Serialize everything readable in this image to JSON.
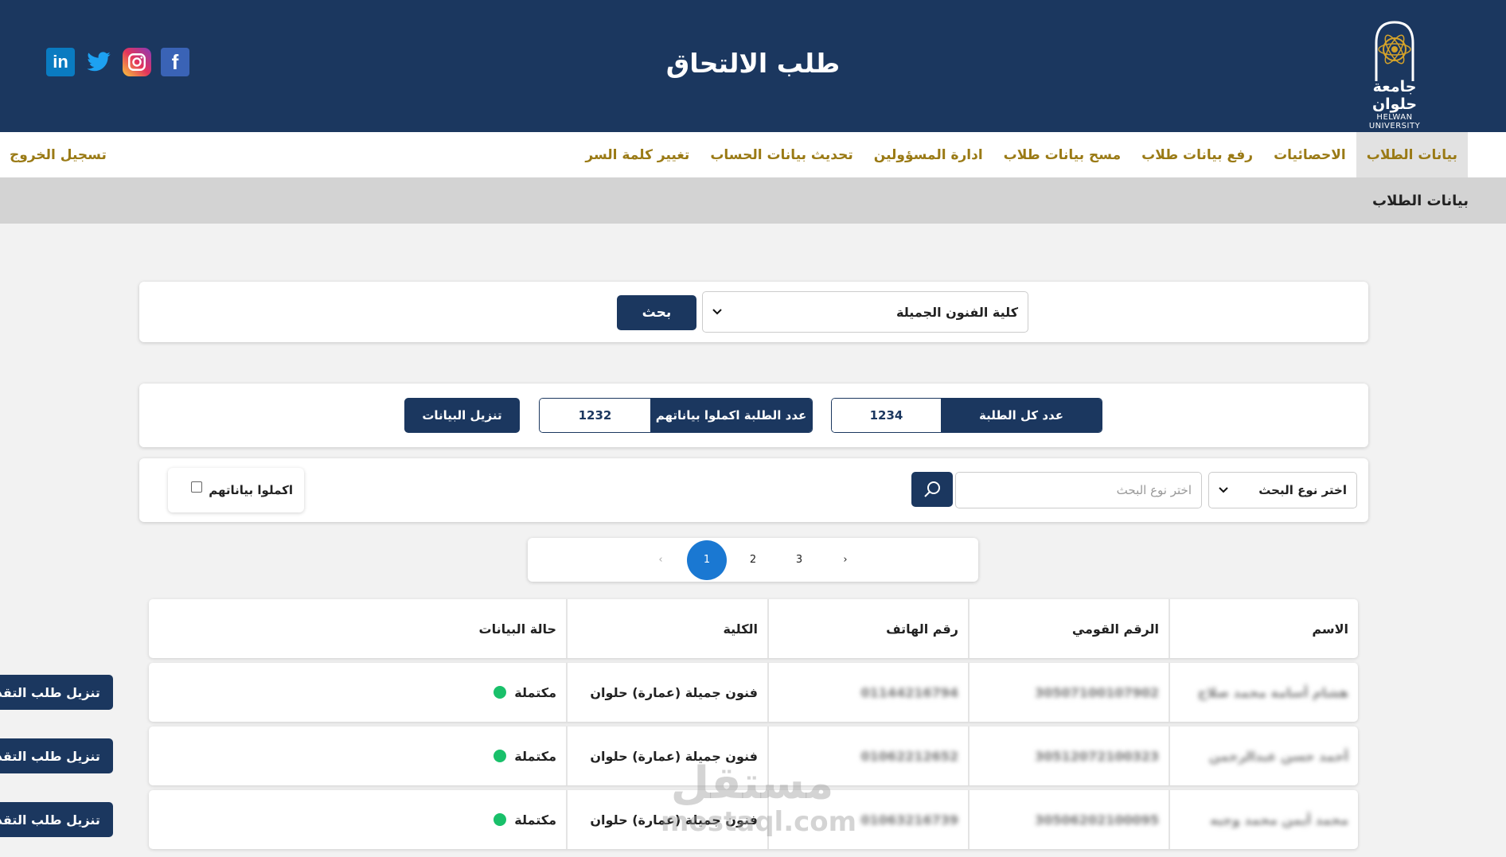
{
  "header": {
    "title": "طلب الالتحاق",
    "logo_ar": "جامعة حلوان",
    "logo_en": "HELWAN UNIVERSITY",
    "social": [
      "linkedin-icon",
      "twitter-icon",
      "instagram-icon",
      "facebook-icon"
    ]
  },
  "nav": {
    "items": [
      {
        "label": "بيانات الطلاب",
        "active": true
      },
      {
        "label": "الاحصائيات"
      },
      {
        "label": "رفع بيانات طلاب"
      },
      {
        "label": "مسح بيانات طلاب"
      },
      {
        "label": "ادارة المسؤولين"
      },
      {
        "label": "تحديث بيانات الحساب"
      },
      {
        "label": "تغيير كلمة السر"
      }
    ],
    "logout": "تسجيل الخروج"
  },
  "breadcrumb": "بيانات الطلاب",
  "faculty_search": {
    "selected": "كلية الفنون الجميلة",
    "button": "بحث"
  },
  "counters": {
    "all_label": "عدد كل الطلبة",
    "all_value": "1234",
    "done_label": "عدد الطلبة اكملوا بياناتهم",
    "done_value": "1232",
    "download_label": "تنزيل البيانات"
  },
  "filter": {
    "type_select": "اختر نوع البحث",
    "search_placeholder": "اختر نوع البحث",
    "checkbox_label": "اكملوا بياناتهم"
  },
  "pagination": {
    "prev": "‹",
    "pages": [
      "1",
      "2",
      "3"
    ],
    "current": "1",
    "next": "›"
  },
  "table": {
    "headers": [
      "الاسم",
      "الرقم القومي",
      "رقم الهاتف",
      "الكلية",
      "حالة البيانات"
    ],
    "rows": [
      {
        "name": "هشام أسامة محمد صلاح",
        "nid": "30507100107902",
        "phone": "01144216794",
        "faculty": "فنون جميلة (عمارة) حلوان",
        "status": "مكتملة",
        "action": "تنزيل طلب التقديم"
      },
      {
        "name": "أحمد حسن عبدالرحمن",
        "nid": "30512072100323",
        "phone": "01062212652",
        "faculty": "فنون جميلة (عمارة) حلوان",
        "status": "مكتملة",
        "action": "تنزيل طلب التقديم"
      },
      {
        "name": "محمد أيمن محمد وجيه",
        "nid": "30506202100095",
        "phone": "01063216739",
        "faculty": "فنون جميلة (عمارة) حلوان",
        "status": "مكتملة",
        "action": "تنزيل طلب التقديم"
      }
    ]
  },
  "watermark": {
    "line1": "مستقل",
    "line2": "mostaql.com"
  },
  "colors": {
    "primary": "#1b375f",
    "gold": "#9a7a15",
    "success": "#19c06a",
    "active_page": "#1a78d2"
  }
}
